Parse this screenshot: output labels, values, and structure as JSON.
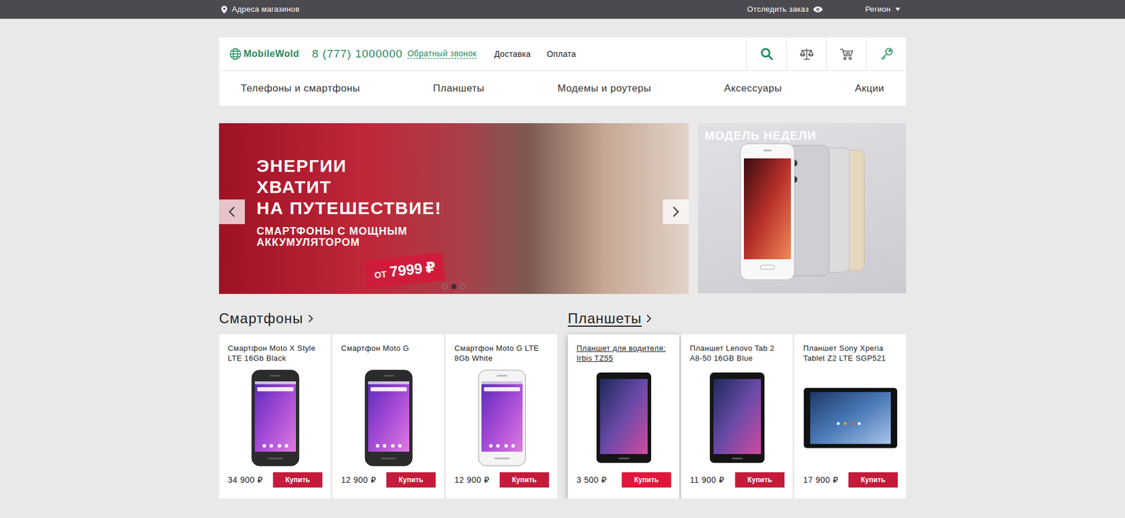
{
  "top_bar": {
    "store_addresses": "Адреса магазинов",
    "track_order": "Отследить заказ",
    "region": "Регион"
  },
  "header": {
    "logo": "MobileWold",
    "phone": "8 (777) 1000000",
    "callback": "Обратный звонок",
    "links": [
      {
        "label": "Доставка"
      },
      {
        "label": "Оплата"
      }
    ]
  },
  "nav": [
    {
      "label": "Телефоны и смартфоны"
    },
    {
      "label": "Планшеты"
    },
    {
      "label": "Модемы и роутеры"
    },
    {
      "label": "Аксессуары"
    },
    {
      "label": "Акции"
    }
  ],
  "slider": {
    "title_lines": [
      "ЭНЕРГИИ",
      "ХВАТИТ",
      "НА ПУТЕШЕСТВИЕ!"
    ],
    "subtitle_lines": [
      "СМАРТФОНЫ С МОЩНЫМ",
      "АККУМУЛЯТОРОМ"
    ],
    "price_prefix": "ОТ",
    "price": "7999",
    "currency": "₽",
    "dots": [
      {
        "selected": false
      },
      {
        "selected": true
      },
      {
        "selected": false
      }
    ]
  },
  "model_of_week": {
    "title": "МОДЕЛЬ НЕДЕЛИ"
  },
  "sections": [
    {
      "title": "Смартфоны",
      "hovered": false,
      "products": [
        {
          "title": "Смартфон Moto X Style LTE 16Gb Black",
          "price": "34 900",
          "currency": "₽",
          "button": "Купить",
          "kind": "darkphone",
          "hovered": false
        },
        {
          "title": "Смартфон Moto G",
          "price": "12 900",
          "currency": "₽",
          "button": "Купить",
          "kind": "darkphone",
          "hovered": false
        },
        {
          "title": "Смартфон Moto G LTE 8Gb White",
          "price": "12 900",
          "currency": "₽",
          "button": "Купить",
          "kind": "whitephone",
          "hovered": false
        }
      ]
    },
    {
      "title": "Планшеты",
      "hovered": true,
      "products": [
        {
          "title": "Планшет для водителя: Irbis TZ55",
          "price": "3 500",
          "currency": "₽",
          "button": "Купить",
          "kind": "tablet",
          "hovered": true
        },
        {
          "title": "Планшет Lenovo Tab 2 A8-50 16GB Blue",
          "price": "11 900",
          "currency": "₽",
          "button": "Купить",
          "kind": "tablet",
          "hovered": false
        },
        {
          "title": "Планшет Sony Xperia Tablet Z2 LTE SGP521",
          "price": "17 900",
          "currency": "₽",
          "button": "Купить",
          "kind": "widetablet",
          "hovered": false
        }
      ]
    }
  ]
}
